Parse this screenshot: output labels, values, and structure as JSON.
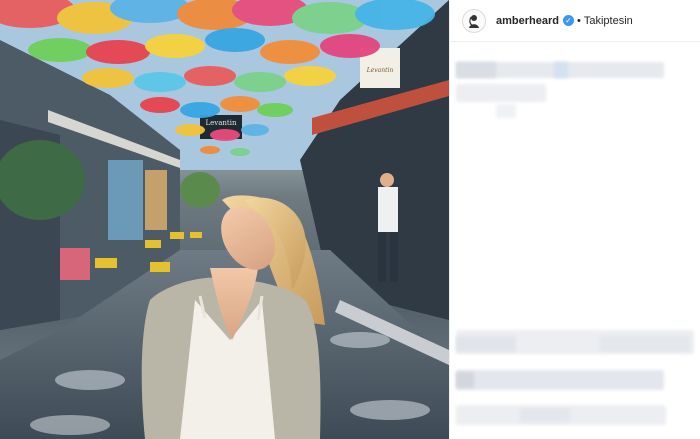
{
  "post": {
    "username": "amberheard",
    "verified": true,
    "separator": "•",
    "follow_state": "Takiptesin"
  },
  "photo": {
    "shop_sign_1": "Levantin",
    "shop_sign_2": "Levantin"
  },
  "icons": {
    "avatar": "profile-avatar-icon",
    "verified": "verified-badge-icon"
  },
  "colors": {
    "verified_blue": "#3897f0",
    "text": "#262626",
    "blur_block": "#e3e6ec"
  }
}
